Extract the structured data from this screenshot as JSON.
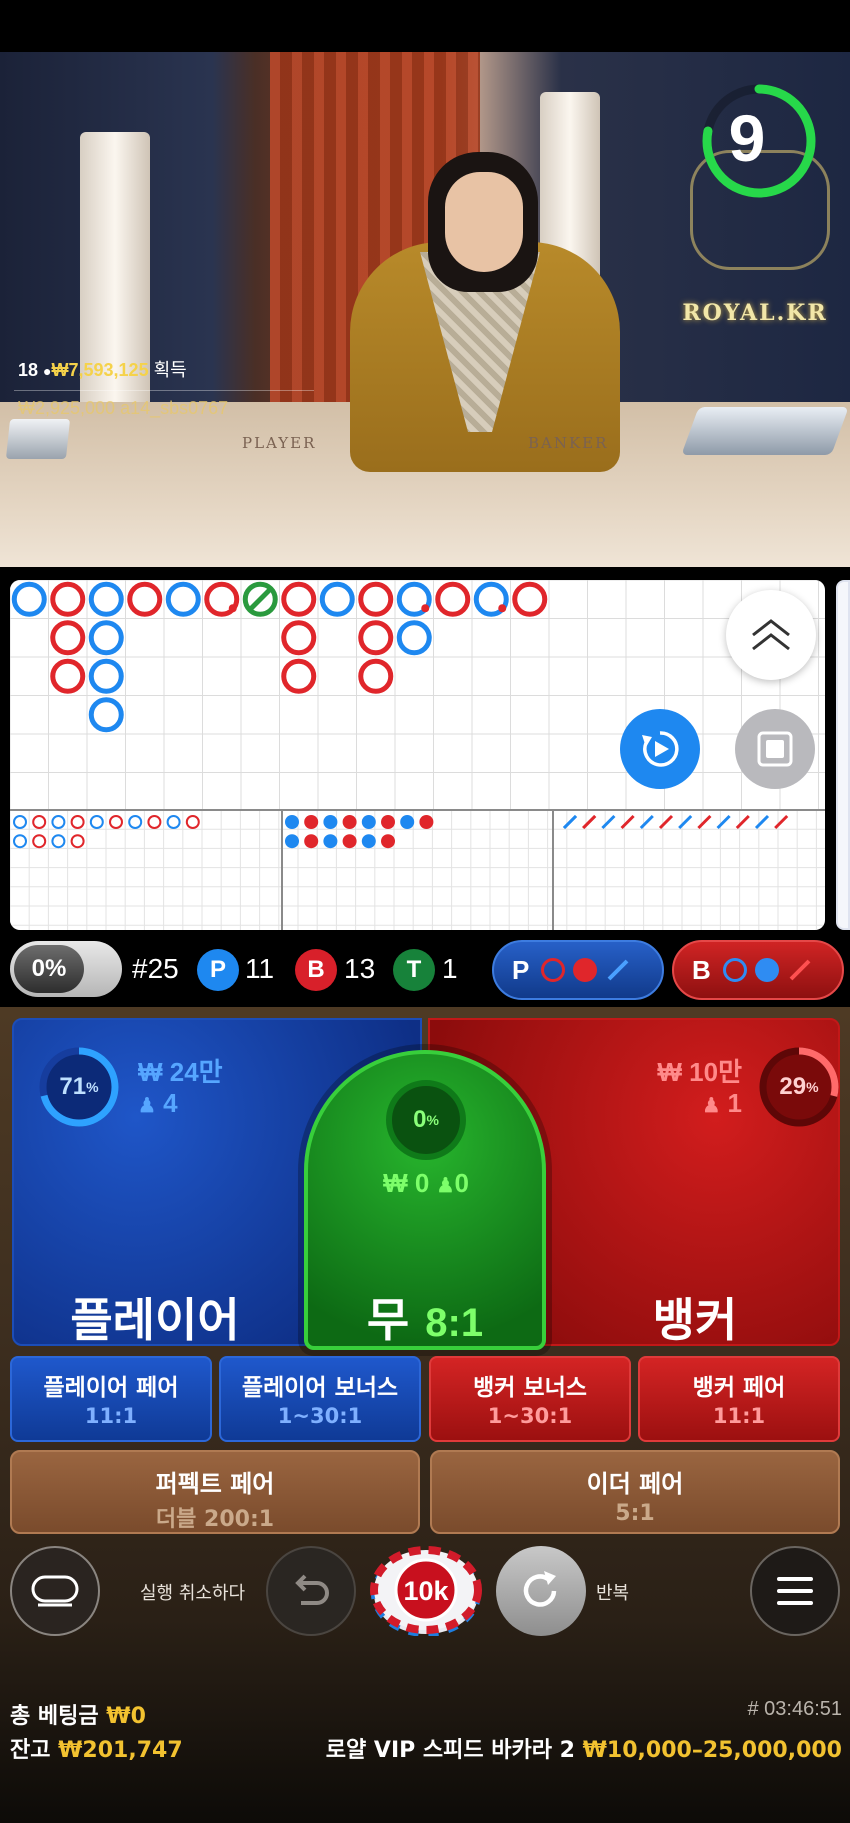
{
  "video": {
    "countdown": "9",
    "countdown_fraction": 0.78,
    "logo_text": "ROYAL.KR",
    "table_player_word": "PLAYER",
    "table_banker_word": "BANKER",
    "winner": {
      "count": "18",
      "amount": "₩7,593,125",
      "label": "획득"
    },
    "winner_user": "₩2,925,000  a14_sbs0767"
  },
  "roadmap": {
    "colors": {
      "player": "#1e88f0",
      "banker": "#e0262b",
      "tie": "#2a9a3e"
    },
    "big_road": [
      [
        "P"
      ],
      [
        "B",
        "B",
        "B"
      ],
      [
        "P",
        "P",
        "P",
        "P"
      ],
      [
        "B"
      ],
      [
        "P"
      ],
      [
        "Bx"
      ],
      [
        "T"
      ],
      [
        "B",
        "B",
        "B"
      ],
      [
        "P"
      ],
      [
        "B",
        "B",
        "B"
      ],
      [
        "Pp",
        "P"
      ],
      [
        "B"
      ],
      [
        "Pp"
      ],
      [
        "B"
      ]
    ]
  },
  "stats": {
    "percent_label": "0%",
    "round": "#25",
    "player_letter": "P",
    "player_count": "11",
    "banker_letter": "B",
    "banker_count": "13",
    "tie_letter": "T",
    "tie_count": "1",
    "predict_player": "P",
    "predict_banker": "B"
  },
  "bets": {
    "player": {
      "percent": "71",
      "percent_value": 0.71,
      "amount": "₩ 24만",
      "users": "4",
      "label": "플레이어"
    },
    "tie": {
      "percent": "0",
      "amount": "₩ 0",
      "users": "0",
      "label": "무",
      "odds": "8:1"
    },
    "banker": {
      "percent": "29",
      "percent_value": 0.29,
      "amount": "₩ 10만",
      "users": "1",
      "label": "뱅커"
    },
    "side": [
      {
        "title": "플레이어 페어",
        "odds": "11:1"
      },
      {
        "title": "플레이어 보너스",
        "odds": "1~30:1"
      },
      {
        "title": "뱅커 보너스",
        "odds": "1~30:1"
      },
      {
        "title": "뱅커 페어",
        "odds": "11:1"
      }
    ],
    "perfect_pair": {
      "title": "퍼펙트 페어",
      "odds": "더블 200:1"
    },
    "either_pair": {
      "title": "이더 페어",
      "odds": "5:1"
    },
    "percent_sign": "%"
  },
  "controls": {
    "undo_label": "실행 취소하다",
    "repeat_label": "반복",
    "chip_value": "10k"
  },
  "footer": {
    "total_bet_label": "총 베팅금",
    "total_bet_value": "₩0",
    "balance_label": "잔고",
    "balance_value": "₩201,747",
    "table_name": "로얄 VIP 스피드 바카라 2",
    "limits": "₩10,000–25,000,000",
    "round_id": "# 03:46:51"
  }
}
